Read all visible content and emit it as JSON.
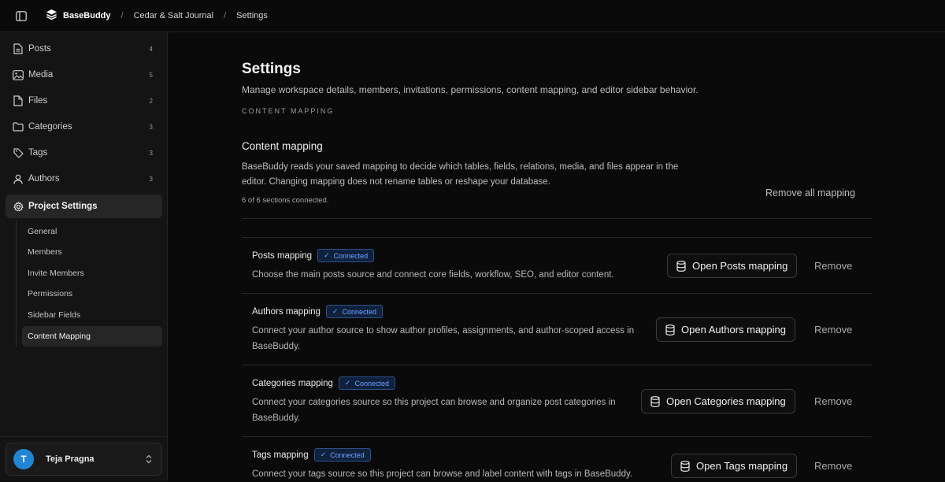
{
  "topbar": {
    "brand": "BaseBuddy",
    "breadcrumbs": [
      "Cedar & Salt Journal",
      "Settings"
    ],
    "separator": "/"
  },
  "sidebar": {
    "items": [
      {
        "label": "Posts",
        "count": "4",
        "icon": "document-icon"
      },
      {
        "label": "Media",
        "count": "5",
        "icon": "image-icon"
      },
      {
        "label": "Files",
        "count": "2",
        "icon": "file-icon"
      },
      {
        "label": "Categories",
        "count": "3",
        "icon": "folder-icon"
      },
      {
        "label": "Tags",
        "count": "3",
        "icon": "tag-icon"
      },
      {
        "label": "Authors",
        "count": "3",
        "icon": "user-icon"
      },
      {
        "label": "Project Settings",
        "count": "",
        "icon": "gear-icon"
      }
    ],
    "sub_items": [
      "General",
      "Members",
      "Invite Members",
      "Permissions",
      "Sidebar Fields",
      "Content Mapping"
    ],
    "user": {
      "initial": "T",
      "name": "Teja Pragna"
    }
  },
  "main": {
    "title": "Settings",
    "description": "Manage workspace details, members, invitations, permissions, content mapping, and editor sidebar behavior.",
    "section_label": "CONTENT MAPPING",
    "cm_title": "Content mapping",
    "cm_description": "BaseBuddy reads your saved mapping to decide which tables, fields, relations, media, and files appear in the editor. Changing mapping does not rename tables or reshape your database.",
    "cm_status": "6 of 6 sections connected.",
    "remove_all": "Remove all mapping",
    "badge_label": "Connected",
    "remove_label": "Remove",
    "rows": [
      {
        "title": "Posts mapping",
        "description": "Choose the main posts source and connect core fields, workflow, SEO, and editor content.",
        "button": "Open Posts mapping"
      },
      {
        "title": "Authors mapping",
        "description": "Connect your author source to show author profiles, assignments, and author-scoped access in BaseBuddy.",
        "button": "Open Authors mapping"
      },
      {
        "title": "Categories mapping",
        "description": "Connect your categories source so this project can browse and organize post categories in BaseBuddy.",
        "button": "Open Categories mapping"
      },
      {
        "title": "Tags mapping",
        "description": "Connect your tags source so this project can browse and label content with tags in BaseBuddy.",
        "button": "Open Tags mapping"
      }
    ]
  },
  "colors": {
    "accent": "#1f86d6",
    "badge_text": "#6ea2ff",
    "background": "#0a0a0a",
    "sidebar": "#141414"
  }
}
